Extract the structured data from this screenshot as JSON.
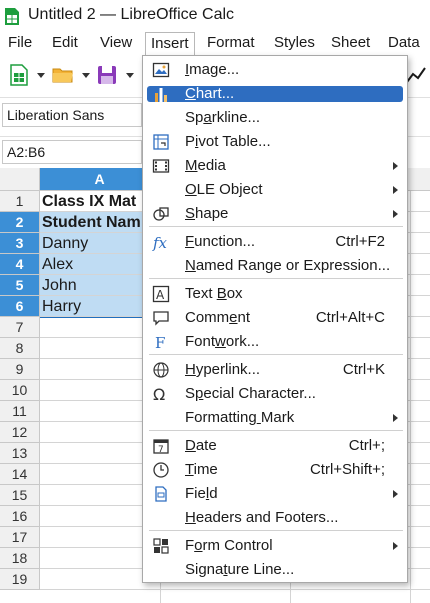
{
  "window": {
    "title": "Untitled 2 — LibreOffice Calc"
  },
  "menubar": [
    "File",
    "Edit",
    "View",
    "Insert",
    "Format",
    "Styles",
    "Sheet",
    "Data"
  ],
  "formatting": {
    "font_name": "Liberation Sans"
  },
  "formula": {
    "name_box": "A2:B6"
  },
  "grid": {
    "columns": [
      "A"
    ],
    "rows": [
      "1",
      "2",
      "3",
      "4",
      "5",
      "6",
      "7",
      "8",
      "9",
      "10",
      "11",
      "12",
      "13",
      "14",
      "15",
      "16",
      "17",
      "18",
      "19"
    ],
    "cells_a": [
      "Class IX Mat",
      "Student Nam",
      "Danny",
      "Alex",
      "John",
      "Harry"
    ]
  },
  "insert_menu": {
    "items": [
      {
        "label": "Image...",
        "shortcut": "",
        "submenu": false,
        "icon": "image-icon"
      },
      {
        "label": "Chart...",
        "shortcut": "",
        "submenu": false,
        "icon": "chart-icon",
        "highlighted": true
      },
      {
        "label": "Sparkline...",
        "shortcut": "",
        "submenu": false,
        "icon": ""
      },
      {
        "label": "Pivot Table...",
        "shortcut": "",
        "submenu": false,
        "icon": "pivot-table-icon"
      },
      {
        "label": "Media",
        "shortcut": "",
        "submenu": true,
        "icon": "media-icon"
      },
      {
        "label": "OLE Object",
        "shortcut": "",
        "submenu": true,
        "icon": ""
      },
      {
        "label": "Shape",
        "shortcut": "",
        "submenu": true,
        "icon": "shape-icon"
      },
      {
        "label": "Function...",
        "shortcut": "Ctrl+F2",
        "submenu": false,
        "icon": "function-icon"
      },
      {
        "label": "Named Range or Expression...",
        "shortcut": "",
        "submenu": false,
        "icon": ""
      },
      {
        "label": "Text Box",
        "shortcut": "",
        "submenu": false,
        "icon": "text-box-icon"
      },
      {
        "label": "Comment",
        "shortcut": "Ctrl+Alt+C",
        "submenu": false,
        "icon": "comment-icon"
      },
      {
        "label": "Fontwork...",
        "shortcut": "",
        "submenu": false,
        "icon": "fontwork-icon"
      },
      {
        "label": "Hyperlink...",
        "shortcut": "Ctrl+K",
        "submenu": false,
        "icon": "hyperlink-icon"
      },
      {
        "label": "Special Character...",
        "shortcut": "",
        "submenu": false,
        "icon": "special-character-icon"
      },
      {
        "label": "Formatting Mark",
        "shortcut": "",
        "submenu": true,
        "icon": ""
      },
      {
        "label": "Date",
        "shortcut": "Ctrl+;",
        "submenu": false,
        "icon": "date-icon"
      },
      {
        "label": "Time",
        "shortcut": "Ctrl+Shift+;",
        "submenu": false,
        "icon": "time-icon"
      },
      {
        "label": "Field",
        "shortcut": "",
        "submenu": true,
        "icon": "field-icon"
      },
      {
        "label": "Headers and Footers...",
        "shortcut": "",
        "submenu": false,
        "icon": ""
      },
      {
        "label": "Form Control",
        "shortcut": "",
        "submenu": true,
        "icon": "form-control-icon"
      },
      {
        "label": "Signature Line...",
        "shortcut": "",
        "submenu": false,
        "icon": ""
      }
    ]
  },
  "colors": {
    "accent": "#2e6dc0",
    "selection": "#bfdcf3",
    "header_selected": "#3c8fd6"
  }
}
